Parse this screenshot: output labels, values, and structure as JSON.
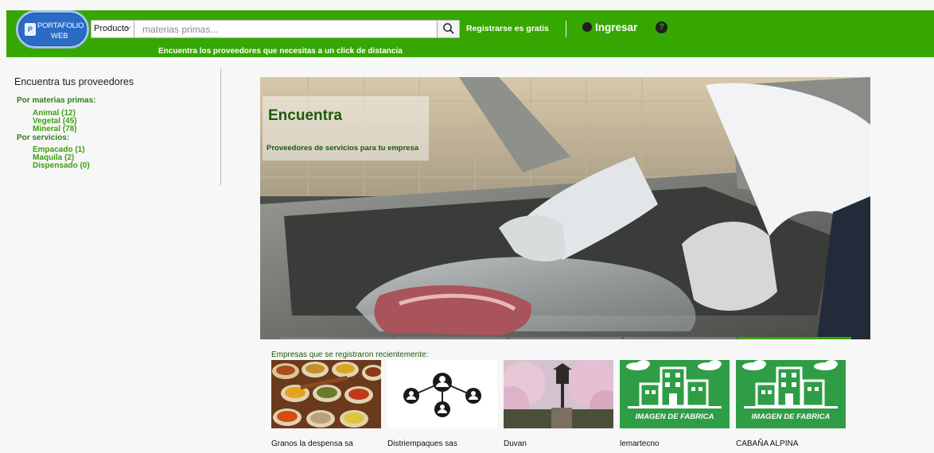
{
  "header": {
    "logo_line1": "PORTAFOLIO",
    "logo_line2": "WEB",
    "search_select": "Producto",
    "search_placeholder": "materias primas...",
    "register_label": "Registrarse es gratis",
    "login_label": "Ingresar",
    "help_glyph": "?",
    "tagline": "Encuentra los proveedores que necesitas a un click de distancia"
  },
  "sidebar": {
    "title": "Encuentra tus proveedores",
    "groups": [
      {
        "heading": "Por materias primas:",
        "items": [
          "Animal (12)",
          "Vegetal (45)",
          "Mineral (78)"
        ]
      },
      {
        "heading": "Por servicios:",
        "items": [
          "Empacado (1)",
          "Maquila (2)",
          "Dispensado (0)"
        ]
      }
    ]
  },
  "hero": {
    "title": "Encuentra",
    "subtitle": "Proveedores de servicios para tu empresa",
    "slide_count": 5,
    "active_slide": 4
  },
  "recent": {
    "label": "Empresas que se registraron recientemente:",
    "companies": [
      {
        "name": "Granos la despensa sa",
        "image": "spices"
      },
      {
        "name": "Distriempaques sas",
        "image": "network"
      },
      {
        "name": "Duvan",
        "image": "blossom"
      },
      {
        "name": "lemartecno",
        "image": "factory",
        "image_text": "IMAGEN DE FABRICA"
      },
      {
        "name": "CABAÑA ALPINA",
        "image": "factory",
        "image_text": "IMAGEN DE FABRICA"
      }
    ]
  },
  "colors": {
    "brand_green": "#36a700",
    "link_green": "#3aa00f",
    "dark_green": "#1c5a0c",
    "logo_blue": "#2a6bc4"
  }
}
